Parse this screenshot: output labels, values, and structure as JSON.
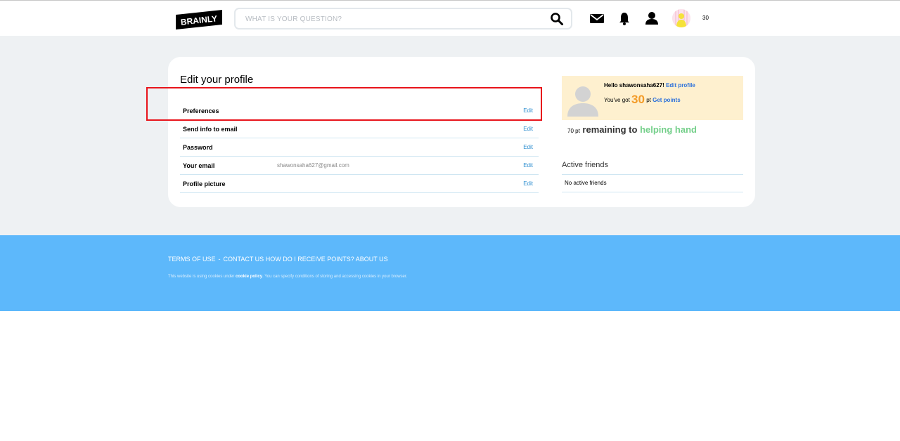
{
  "header": {
    "logo_text": "BRAINLY",
    "search_placeholder": "WHAT IS YOUR QUESTION?",
    "points": "30"
  },
  "profile": {
    "title": "Edit your profile",
    "rows": [
      {
        "label": "Preferences",
        "value": "",
        "action": "Edit"
      },
      {
        "label": "Send info to email",
        "value": "",
        "action": "Edit"
      },
      {
        "label": "Password",
        "value": "",
        "action": "Edit"
      },
      {
        "label": "Your email",
        "value": "shawonsaha627@gmail.com",
        "action": "Edit"
      },
      {
        "label": "Profile picture",
        "value": "",
        "action": "Edit"
      }
    ]
  },
  "sidebar": {
    "hello_prefix": "Hello ",
    "username": "shawonsaha627",
    "hello_suffix": "!",
    "edit_profile": "Edit profile",
    "got_prefix": "You've got ",
    "points": "30",
    "pt_unit": "pt",
    "get_points": "Get points",
    "remaining_pts": "70 pt",
    "remaining_text": "remaining to",
    "rank_name": "helping hand",
    "friends_title": "Active friends",
    "friends_empty": "No active friends"
  },
  "footer": {
    "links": [
      "TERMS OF USE",
      "CONTACT US",
      "HOW DO I RECEIVE POINTS?",
      "ABOUT US"
    ],
    "link_separator": "-",
    "cookie_prefix": "This website is using cookies under ",
    "cookie_link": "cookie policy",
    "cookie_suffix": ". You can specify conditions of storing and accessing cookies in your browser."
  },
  "colors": {
    "accent_blue": "#5db8fb",
    "link_blue": "#2f8fd0",
    "highlight_red": "#e8141b",
    "points_orange": "#f39b27",
    "rank_green": "#74cf8a",
    "hello_bg": "#fef0cf"
  }
}
